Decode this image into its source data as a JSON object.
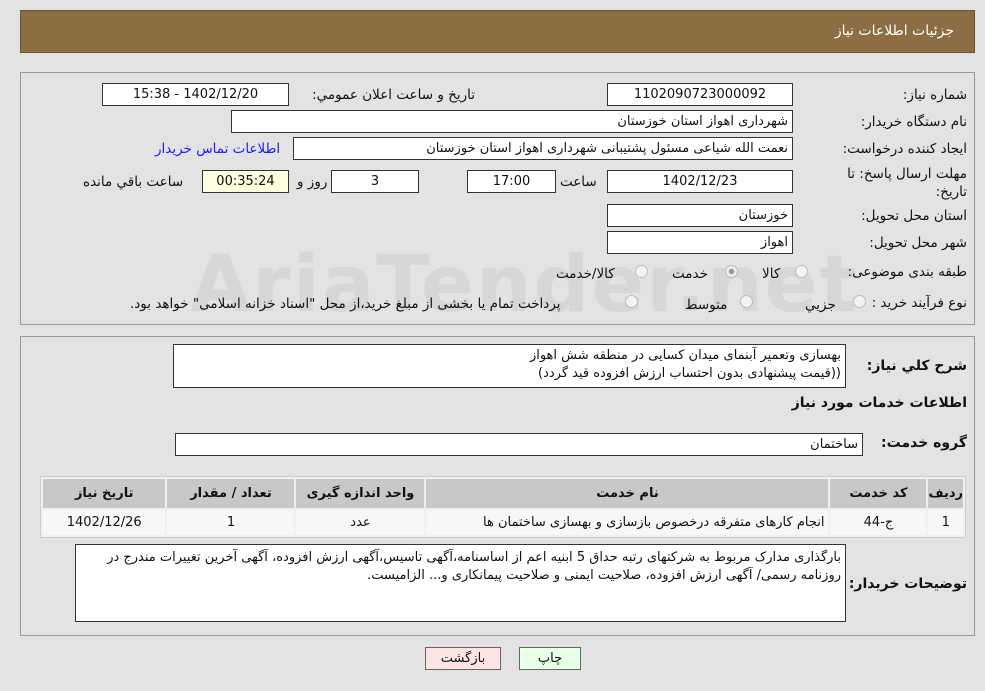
{
  "header": {
    "title": "جزئیات اطلاعات نیاز"
  },
  "form": {
    "need_number_label": "شماره نیاز:",
    "need_number": "1102090723000092",
    "announce_label": "تاريخ و ساعت اعلان عمومي:",
    "announce_value": "1402/12/20 - 15:38",
    "buyer_org_label": "نام دستگاه خریدار:",
    "buyer_org": "شهرداری اهواز استان خوزستان",
    "creator_label": "ایجاد کننده درخواست:",
    "creator": "نعمت الله شیاعی مسئول پشتیبانی شهرداری اهواز استان خوزستان",
    "contact_link": "اطلاعات تماس خریدار",
    "deadline_label": "مهلت ارسال پاسخ: تا تاریخ:",
    "deadline_date": "1402/12/23",
    "time_label": "ساعت",
    "deadline_time": "17:00",
    "days": "3",
    "days_label": "روز و",
    "remaining": "00:35:24",
    "remaining_label": "ساعت باقي مانده",
    "province_label": "استان محل تحویل:",
    "province": "خوزستان",
    "city_label": "شهر محل تحویل:",
    "city": "اهواز",
    "category_label": "طبقه بندی موضوعی:",
    "category_options": [
      "کالا",
      "خدمت",
      "کالا/خدمت"
    ],
    "category_selected": "خدمت",
    "process_label": "نوع فرآیند خرید :",
    "process_options": [
      "جزیي",
      "متوسط"
    ],
    "process_note": "پرداخت تمام یا بخشی از مبلغ خرید،از محل \"اسناد خزانه اسلامی\" خواهد بود."
  },
  "details": {
    "desc_label": "شرح کلي نياز:",
    "desc_line1": "بهسازی وتعمیر آبنمای میدان کسایی در منطقه شش اهواز",
    "desc_line2": "((قیمت پیشنهادی بدون احتساب ارزش افزوده قید گردد)",
    "services_title": "اطلاعات خدمات مورد نیاز",
    "group_label": "گروه خدمت:",
    "group": "ساختمان",
    "table": {
      "headers": [
        "ردیف",
        "کد خدمت",
        "نام خدمت",
        "واحد اندازه گیری",
        "تعداد / مقدار",
        "تاریخ نیاز"
      ],
      "rows": [
        [
          "1",
          "ج-44",
          "انجام کارهای متفرقه درخصوص بازسازی و بهسازی ساختمان ها",
          "عدد",
          "1",
          "1402/12/26"
        ]
      ]
    },
    "notes_label": "توضیحات خریدار:",
    "notes": "بارگذاری مدارک مربوط به شرکتهای رتبه حداق 5 ابنیه اعم از اساسنامه،آگهی تاسیس،آگهی ارزش افزوده، آگهی آخرین تغییرات مندرج در روزنامه رسمی/  آگهی ارزش افزوده، صلاحیت ایمنی و صلاحیت پیمانکاری و... الزامیست."
  },
  "buttons": {
    "print": "چاپ",
    "back": "بازگشت"
  },
  "watermark": "AriaTender.net",
  "colors": {
    "header": "#8c6d44",
    "back_button": "#ffe4e4",
    "print_button": "#e8ffe8",
    "link": "#1a1aff"
  }
}
